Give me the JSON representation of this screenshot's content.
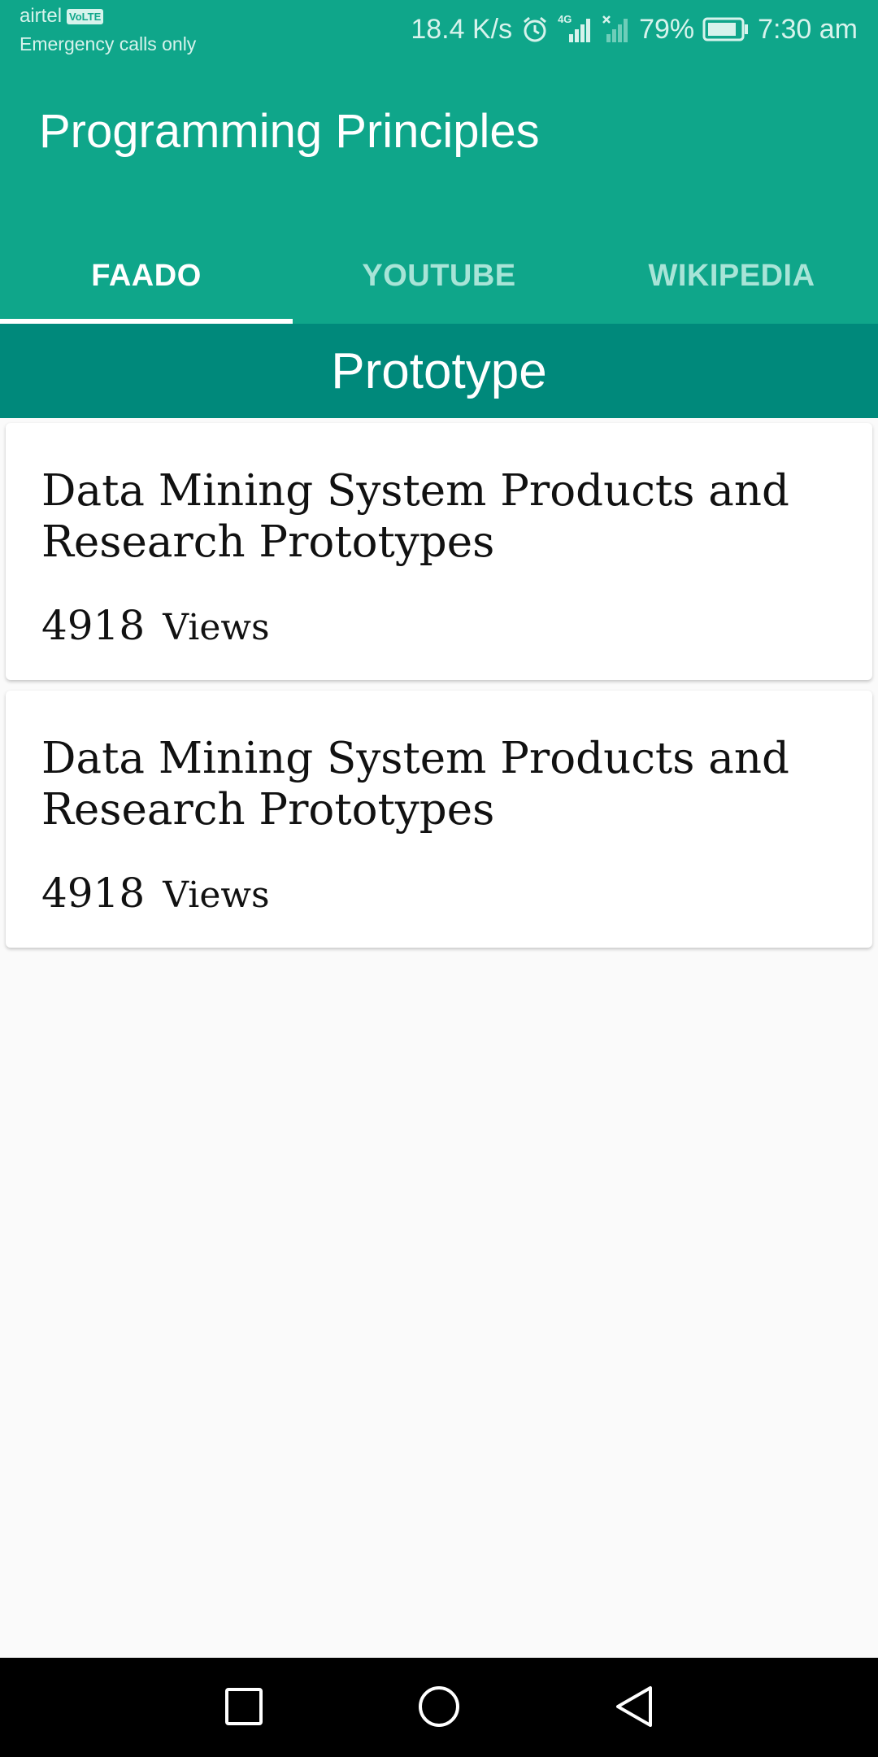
{
  "status_bar": {
    "carrier": "airtel",
    "volte": "VoLTE",
    "emergency": "Emergency calls only",
    "network_speed": "18.4 K/s",
    "network_type": "4G",
    "battery": "79%",
    "time": "7:30 am",
    "icons": [
      "alarm-icon",
      "signal-icon",
      "no-signal-icon",
      "battery-icon"
    ]
  },
  "app_bar": {
    "title": "Programming Principles",
    "background": "#0fa68a"
  },
  "tabs": [
    {
      "label": "FAADO",
      "active": true
    },
    {
      "label": "YOUTUBE",
      "active": false
    },
    {
      "label": "WIKIPEDIA",
      "active": false
    }
  ],
  "section": {
    "title": "Prototype",
    "background": "#00897b"
  },
  "cards": [
    {
      "title": "Data Mining System Products and Research Prototypes",
      "views_count": "4918",
      "views_label": "Views"
    },
    {
      "title": "Data Mining System Products and Research Prototypes",
      "views_count": "4918",
      "views_label": "Views"
    }
  ],
  "nav_bar": {
    "buttons": [
      "recents-icon",
      "home-icon",
      "back-icon"
    ]
  }
}
